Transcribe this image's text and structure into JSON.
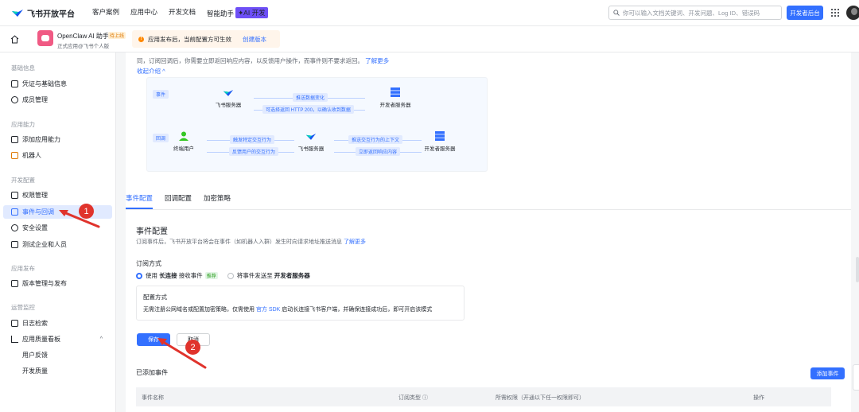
{
  "topbar": {
    "brand": "飞书开放平台",
    "nav": [
      "客户案例",
      "应用中心",
      "开发文档",
      "智能助手"
    ],
    "ai_badge": "✦AI 开发",
    "search_placeholder": "你可以输入文档关键词、开发问题、Log ID、错误码",
    "dev_console": "开发者后台"
  },
  "app": {
    "name": "OpenClaw AI 助手",
    "status": "待上线",
    "owner": "正式应用@飞书个人版"
  },
  "notice": {
    "text": "应用发布后，当前配置方可生效",
    "link": "创建版本"
  },
  "sidebar": {
    "groups": [
      "基础信息",
      "应用能力",
      "开发配置",
      "应用发布",
      "运营监控"
    ],
    "items": [
      "凭证与基础信息",
      "成员管理",
      "添加应用能力",
      "机器人",
      "权限管理",
      "事件与回调",
      "安全设置",
      "测试企业和人员",
      "版本管理与发布",
      "日志检索",
      "应用质量看板",
      "用户反馈",
      "开发质量"
    ]
  },
  "intro": {
    "text_line1": "同，订阅回调后，你需要立即返回响应内容，以反馈用户操作，而事件则不要求返回。",
    "more": "了解更多",
    "collapse": "收起介绍 ^"
  },
  "diagram": {
    "event_tag": "事件",
    "callback_tag": "回调",
    "feishu_server": "飞书服务器",
    "dev_server": "开发者服务器",
    "end_user": "终端用户",
    "push_change": "推送数据变化",
    "return_200": "可选择返回 HTTP 200，以确认收到数据",
    "trigger": "触发特定交互行为",
    "feedback": "反馈用户的交互行为",
    "push_context": "推送交互行为的上下文",
    "return_resp": "立即返回响应内容"
  },
  "tabs": [
    "事件配置",
    "回调配置",
    "加密策略"
  ],
  "config": {
    "title": "事件配置",
    "desc": "订阅事件后，飞书开放平台将会在事件（如机器人入群）发生时向请求地址推送消息",
    "desc_more": "了解更多",
    "subscribe_label": "订阅方式",
    "opt1_pre": "使用",
    "opt1_bold": "长连接",
    "opt1_post": "接收事件",
    "opt1_badge": "推荐",
    "opt2_pre": "将事件发送至",
    "opt2_bold": "开发者服务器",
    "box_title": "配置方式",
    "box_text_pre": "无需注册公网域名或配置加密策略，仅需使用",
    "box_link": "官方 SDK",
    "box_text_post": "启动长连接飞书客户端，并确保连接成功后，即可开启该模式",
    "save": "保存",
    "cancel": "取消",
    "added_title": "已添加事件",
    "add_event": "添加事件",
    "columns": [
      "事件名称",
      "订阅类型 ⓘ",
      "所需权限（开通以下任一权限即可）",
      "操作"
    ]
  },
  "annotations": [
    "1",
    "2"
  ],
  "colors": {
    "accent": "#3370ff",
    "annotation": "#e0332c"
  }
}
